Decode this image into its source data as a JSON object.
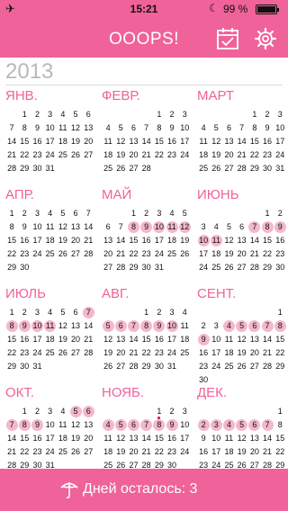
{
  "status": {
    "time": "15:21",
    "battery": "99 %",
    "battery_level": 0.99
  },
  "app": {
    "title": "OOOPS!"
  },
  "year": "2013",
  "months": [
    {
      "name": "ЯНВ.",
      "offset": 1,
      "days": 31,
      "highlight": [],
      "marked": []
    },
    {
      "name": "ФЕВР.",
      "offset": 4,
      "days": 28,
      "highlight": [],
      "marked": []
    },
    {
      "name": "МАРТ",
      "offset": 4,
      "days": 31,
      "highlight": [],
      "marked": []
    },
    {
      "name": "АПР.",
      "offset": 0,
      "days": 30,
      "highlight": [],
      "marked": []
    },
    {
      "name": "МАЙ",
      "offset": 2,
      "days": 31,
      "highlight": [
        8,
        9,
        10,
        11,
        12
      ],
      "marked": []
    },
    {
      "name": "ИЮНЬ",
      "offset": 5,
      "days": 30,
      "highlight": [
        7,
        8,
        9,
        10,
        11
      ],
      "marked": []
    },
    {
      "name": "ИЮЛЬ",
      "offset": 0,
      "days": 31,
      "highlight": [
        7,
        8,
        9,
        10,
        11
      ],
      "marked": []
    },
    {
      "name": "АВГ.",
      "offset": 3,
      "days": 31,
      "highlight": [
        5,
        6,
        7,
        8,
        9,
        10
      ],
      "marked": []
    },
    {
      "name": "СЕНТ.",
      "offset": 6,
      "days": 30,
      "highlight": [
        4,
        5,
        6,
        7,
        8,
        9
      ],
      "marked": []
    },
    {
      "name": "ОКТ.",
      "offset": 1,
      "days": 31,
      "highlight": [
        5,
        6,
        7,
        8,
        9
      ],
      "marked": []
    },
    {
      "name": "НОЯБ.",
      "offset": 4,
      "days": 30,
      "highlight": [
        4,
        5,
        6,
        7,
        8,
        9
      ],
      "marked": [
        8
      ]
    },
    {
      "name": "ДЕК.",
      "offset": 6,
      "days": 31,
      "highlight": [
        2,
        3,
        4,
        5,
        6,
        7
      ],
      "marked": []
    }
  ],
  "footer": {
    "days_left": "Дней осталось: 3"
  }
}
